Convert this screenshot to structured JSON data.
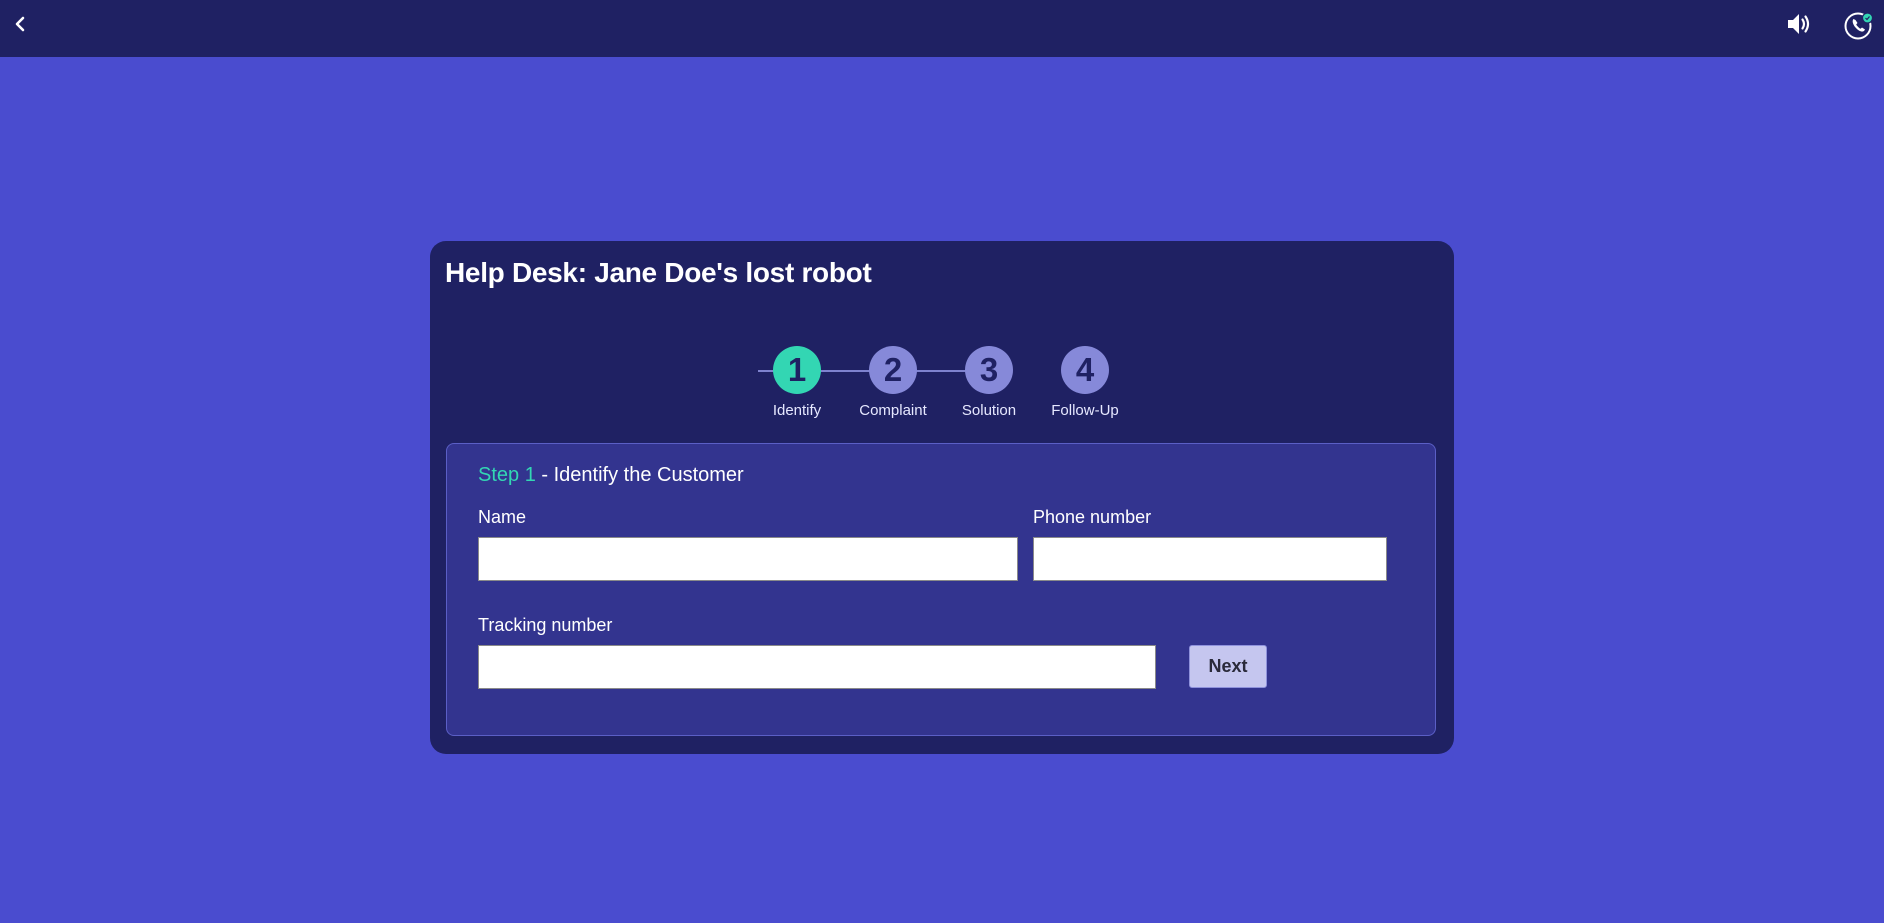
{
  "topbar": {
    "back_icon": "chevron-left-icon",
    "sound_icon": "speaker-icon",
    "phone_icon": "phone-call-icon",
    "accent_color": "#33d6b3"
  },
  "card": {
    "title": "Help Desk: Jane Doe's lost robot"
  },
  "stepper": {
    "active_step": 1,
    "steps": [
      {
        "number": "1",
        "label": "Identify"
      },
      {
        "number": "2",
        "label": "Complaint"
      },
      {
        "number": "3",
        "label": "Solution"
      },
      {
        "number": "4",
        "label": "Follow-Up"
      }
    ]
  },
  "panel": {
    "step_tag": "Step 1",
    "heading": " - Identify the Customer",
    "fields": {
      "name_label": "Name",
      "name_value": "",
      "phone_label": "Phone number",
      "phone_value": "",
      "tracking_label": "Tracking number",
      "tracking_value": ""
    },
    "next_label": "Next"
  },
  "colors": {
    "page_bg": "#4a4ccf",
    "card_bg": "#1f2163",
    "panel_bg": "#33348f",
    "active_step": "#33d6b3",
    "inactive_step": "#8689d9"
  }
}
